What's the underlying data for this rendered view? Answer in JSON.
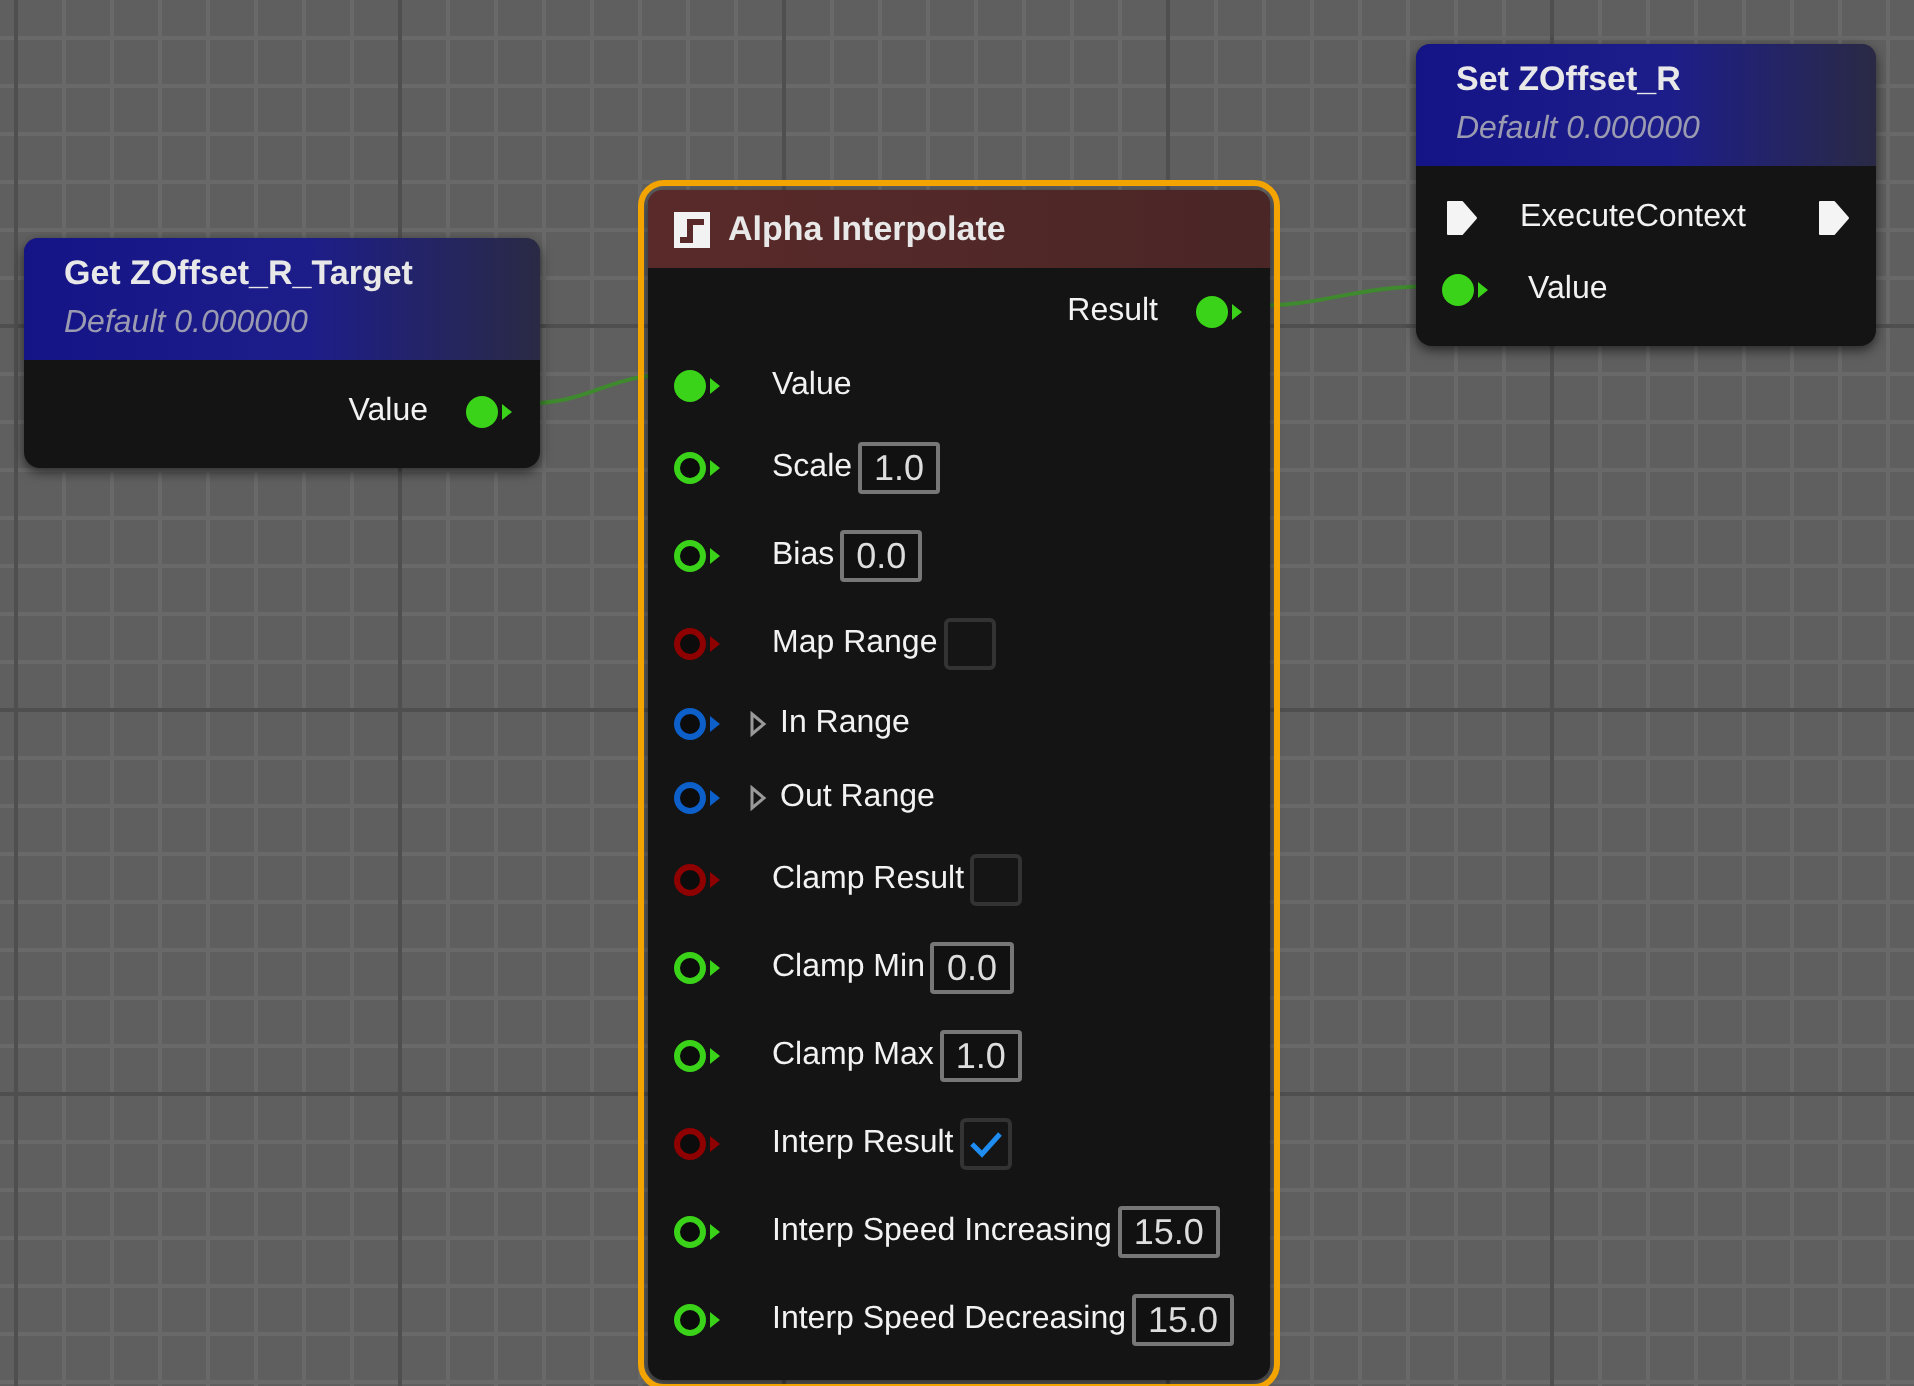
{
  "nodes": [
    {
      "kind": "get",
      "title": "Get ZOffset_R_Target",
      "subtitle": "Default 0.000000",
      "selected": false,
      "rows": [
        {
          "kind": "output",
          "color": "#3ad319",
          "connected": true,
          "label": "Value"
        }
      ]
    },
    {
      "kind": "function",
      "title": "Alpha Interpolate",
      "selected": true,
      "rows": [
        {
          "kind": "output",
          "color": "#3ad319",
          "connected": true,
          "label": "Result"
        },
        {
          "kind": "input",
          "color": "#3ad319",
          "connected": true,
          "label": "Value"
        },
        {
          "kind": "input",
          "color": "#3ad319",
          "connected": false,
          "label": "Scale",
          "value": "1.0"
        },
        {
          "kind": "input",
          "color": "#3ad319",
          "connected": false,
          "label": "Bias",
          "value": "0.0"
        },
        {
          "kind": "input",
          "color": "#8f0000",
          "connected": false,
          "label": "Map Range",
          "checked": false
        },
        {
          "kind": "input",
          "color": "#0d5fc9",
          "connected": false,
          "label": "In Range",
          "expandable": true
        },
        {
          "kind": "input",
          "color": "#0d5fc9",
          "connected": false,
          "label": "Out Range",
          "expandable": true
        },
        {
          "kind": "input",
          "color": "#8f0000",
          "connected": false,
          "label": "Clamp Result",
          "checked": false
        },
        {
          "kind": "input",
          "color": "#3ad319",
          "connected": false,
          "label": "Clamp Min",
          "value": "0.0"
        },
        {
          "kind": "input",
          "color": "#3ad319",
          "connected": false,
          "label": "Clamp Max",
          "value": "1.0"
        },
        {
          "kind": "input",
          "color": "#8f0000",
          "connected": false,
          "label": "Interp Result",
          "checked": true
        },
        {
          "kind": "input",
          "color": "#3ad319",
          "connected": false,
          "label": "Interp Speed Increasing",
          "value": "15.0"
        },
        {
          "kind": "input",
          "color": "#3ad319",
          "connected": false,
          "label": "Interp Speed Decreasing",
          "value": "15.0"
        }
      ]
    },
    {
      "kind": "set",
      "title": "Set ZOffset_R",
      "subtitle": "Default 0.000000",
      "selected": false,
      "rows": [
        {
          "kind": "exec",
          "label": "ExecuteContext"
        },
        {
          "kind": "input",
          "color": "#3ad319",
          "connected": true,
          "label": "Value"
        }
      ]
    }
  ]
}
